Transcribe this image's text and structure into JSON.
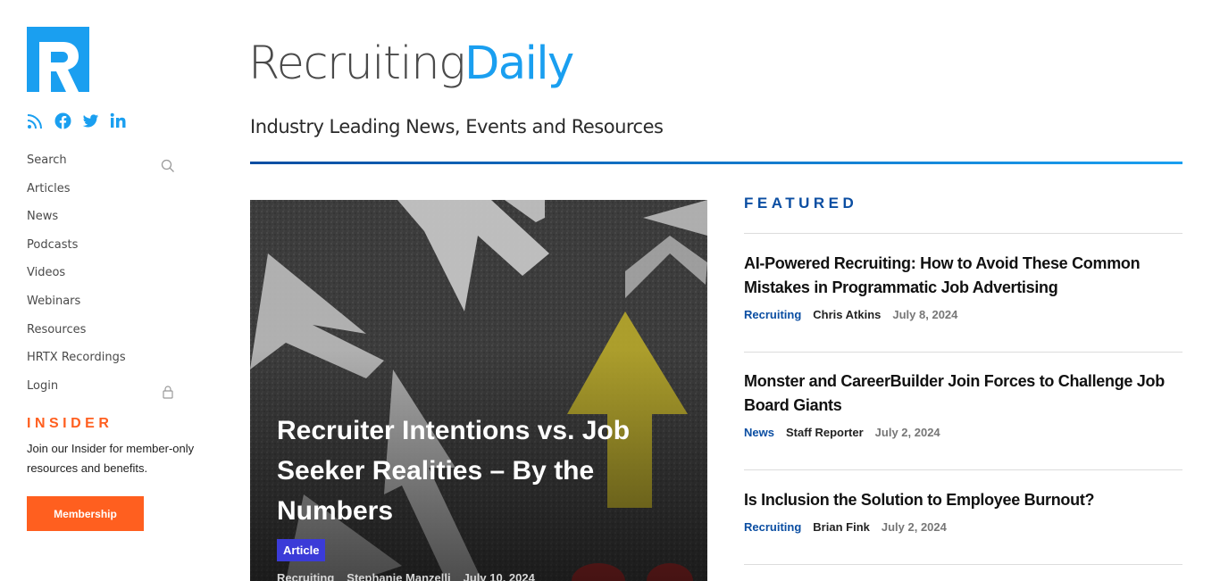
{
  "brand": {
    "part1": "Recruiting",
    "part2": "Daily",
    "tagline": "Industry Leading News, Events and Resources"
  },
  "colors": {
    "accent_blue": "#1a9ff0",
    "dark_blue": "#0b4ea2",
    "orange": "#ff5f1f"
  },
  "social": [
    {
      "icon": "rss-icon"
    },
    {
      "icon": "facebook-icon"
    },
    {
      "icon": "twitter-icon"
    },
    {
      "icon": "linkedin-icon"
    }
  ],
  "nav": {
    "search": "Search",
    "articles": "Articles",
    "news": "News",
    "podcasts": "Podcasts",
    "videos": "Videos",
    "webinars": "Webinars",
    "resources": "Resources",
    "hrtx": "HRTX Recordings",
    "login": "Login"
  },
  "insider": {
    "title": "INSIDER",
    "text": "Join our Insider for member-only resources and benefits.",
    "button": "Membership"
  },
  "hero": {
    "title": "Recruiter Intentions vs. Job Seeker Realities – By the Numbers",
    "badge": "Article",
    "category": "Recruiting",
    "author": "Stephanie Manzelli",
    "date": "July 10, 2024"
  },
  "featured": {
    "title": "FEATURED",
    "items": [
      {
        "title": "AI-Powered Recruiting: How to Avoid These Common Mistakes in Programmatic Job Advertising",
        "category": "Recruiting",
        "author": "Chris Atkins",
        "date": "July 8, 2024"
      },
      {
        "title": "Monster and CareerBuilder Join Forces to Challenge Job Board Giants",
        "category": "News",
        "author": "Staff Reporter",
        "date": "July 2, 2024"
      },
      {
        "title": "Is Inclusion the Solution to Employee Burnout?",
        "category": "Recruiting",
        "author": "Brian Fink",
        "date": "July 2, 2024"
      }
    ]
  }
}
